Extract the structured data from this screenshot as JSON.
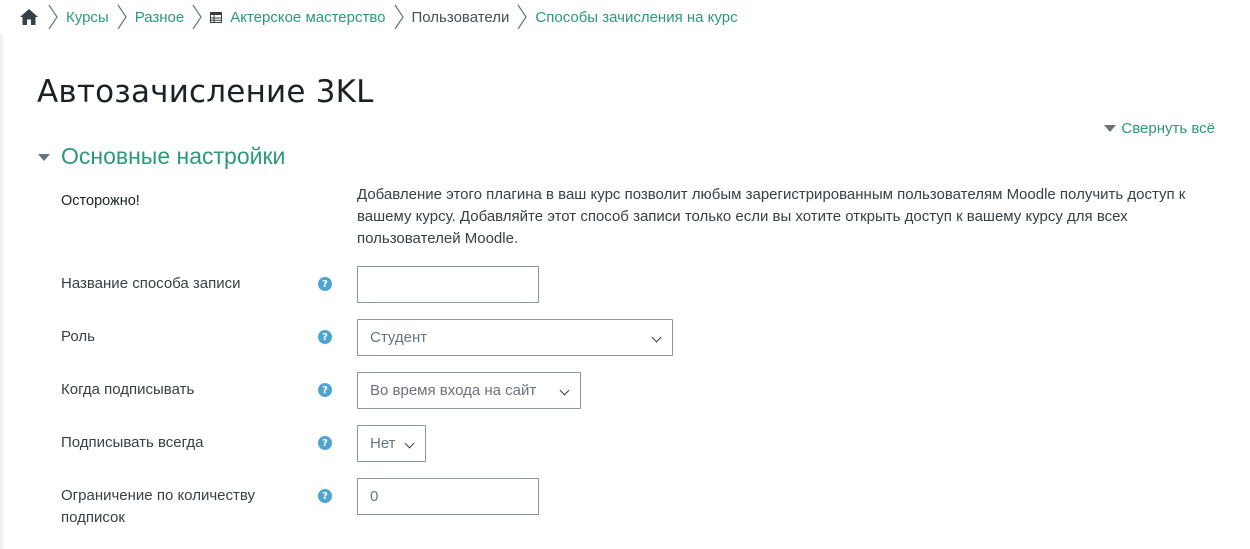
{
  "breadcrumb": {
    "items": [
      {
        "label": "Курсы",
        "kind": "link"
      },
      {
        "label": "Разное",
        "kind": "link"
      },
      {
        "label": "Актерское мастерство",
        "kind": "link",
        "icon": "table-icon"
      },
      {
        "label": "Пользователи",
        "kind": "text"
      },
      {
        "label": "Способы зачисления на курс",
        "kind": "link"
      }
    ]
  },
  "page": {
    "title": "Автозачисление 3KL",
    "collapse_all": "Свернуть всё"
  },
  "section": {
    "title": "Основные настройки"
  },
  "warning": {
    "label": "Осторожно!",
    "text": "Добавление этого плагина в ваш курс позволит любым зарегистрированным пользователям Moodle получить доступ к вашему курсу. Добавляйте этот способ записи только если вы хотите открыть доступ к вашему курсу для всех пользователей Moodle."
  },
  "fields": {
    "name": {
      "label": "Название способа записи",
      "value": ""
    },
    "role": {
      "label": "Роль",
      "value": "Студент"
    },
    "when": {
      "label": "Когда подписывать",
      "value": "Во время входа на сайт"
    },
    "always": {
      "label": "Подписывать всегда",
      "value": "Нет"
    },
    "limit": {
      "label": "Ограничение по количеству подписок",
      "value": "0"
    }
  },
  "colors": {
    "accent": "#2b9a78",
    "help": "#4ea5d1"
  }
}
